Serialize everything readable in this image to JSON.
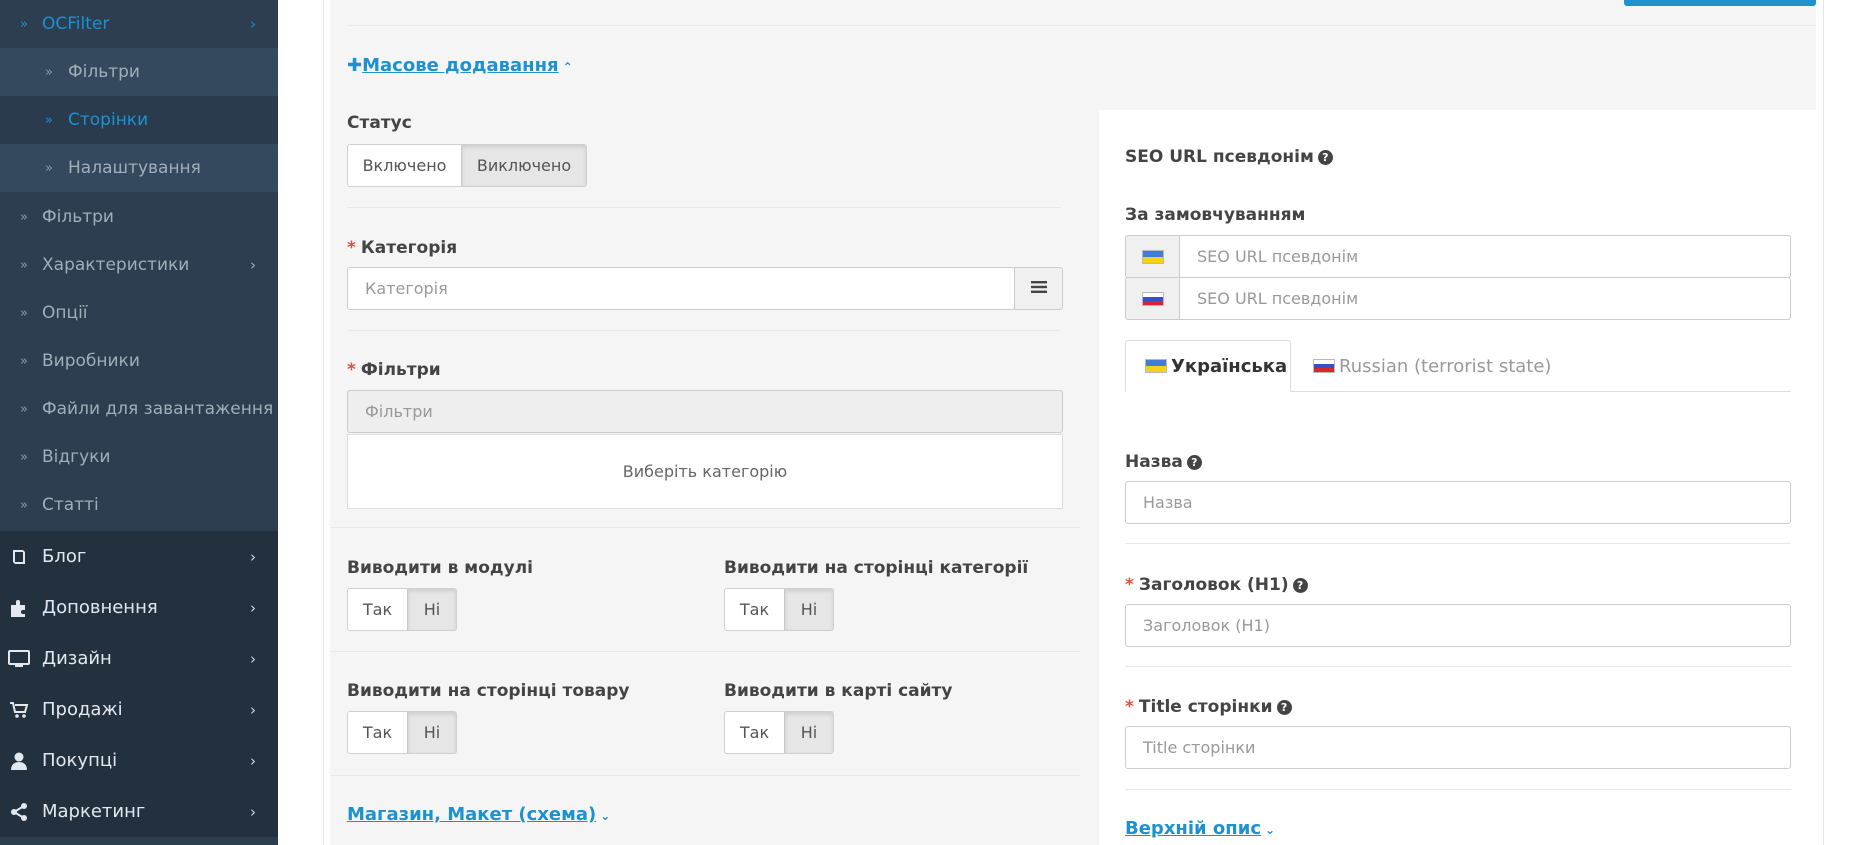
{
  "sidebar": {
    "ocfilter": "OCFilter",
    "sub_items": [
      "Фільтри",
      "Сторінки",
      "Налаштування"
    ],
    "items": [
      "Фільтри",
      "Характеристики",
      "Опції",
      "Виробники",
      "Файли для завантаження",
      "Відгуки",
      "Статті"
    ],
    "main": [
      "Блог",
      "Доповнення",
      "Дизайн",
      "Продажі",
      "Покупці",
      "Маркетинг"
    ]
  },
  "form": {
    "bulk_add_link": "Масове додавання",
    "status": {
      "label": "Статус",
      "on": "Включено",
      "off": "Виключено"
    },
    "category": {
      "label": "Категорія",
      "placeholder": "Категорія"
    },
    "filters": {
      "label": "Фільтри",
      "placeholder": "Фільтри",
      "empty": "Виберіть категорію"
    },
    "module": {
      "label": "Виводити в модулі",
      "yes": "Так",
      "no": "Ні"
    },
    "category_page": {
      "label": "Виводити на сторінці категорії",
      "yes": "Так",
      "no": "Ні"
    },
    "product_page": {
      "label": "Виводити на сторінці товару",
      "yes": "Так",
      "no": "Ні"
    },
    "sitemap": {
      "label": "Виводити в карті сайту",
      "yes": "Так",
      "no": "Ні"
    },
    "store_link": "Магазин, Макет (схема)"
  },
  "seo": {
    "title": "SEO URL псевдонім",
    "default_label": "За замовчуванням",
    "placeholder_ua": "SEO URL псевдонім",
    "placeholder_ru": "SEO URL псевдонім"
  },
  "tabs": {
    "ua": "Українська",
    "ru": "Russian (terrorist state)"
  },
  "fields": {
    "name": {
      "label": "Назва",
      "placeholder": "Назва"
    },
    "h1": {
      "label": "Заголовок (H1)",
      "placeholder": "Заголовок (H1)"
    },
    "title": {
      "label": "Title сторінки",
      "placeholder": "Title сторінки"
    },
    "top_desc_link": "Верхній опис"
  }
}
